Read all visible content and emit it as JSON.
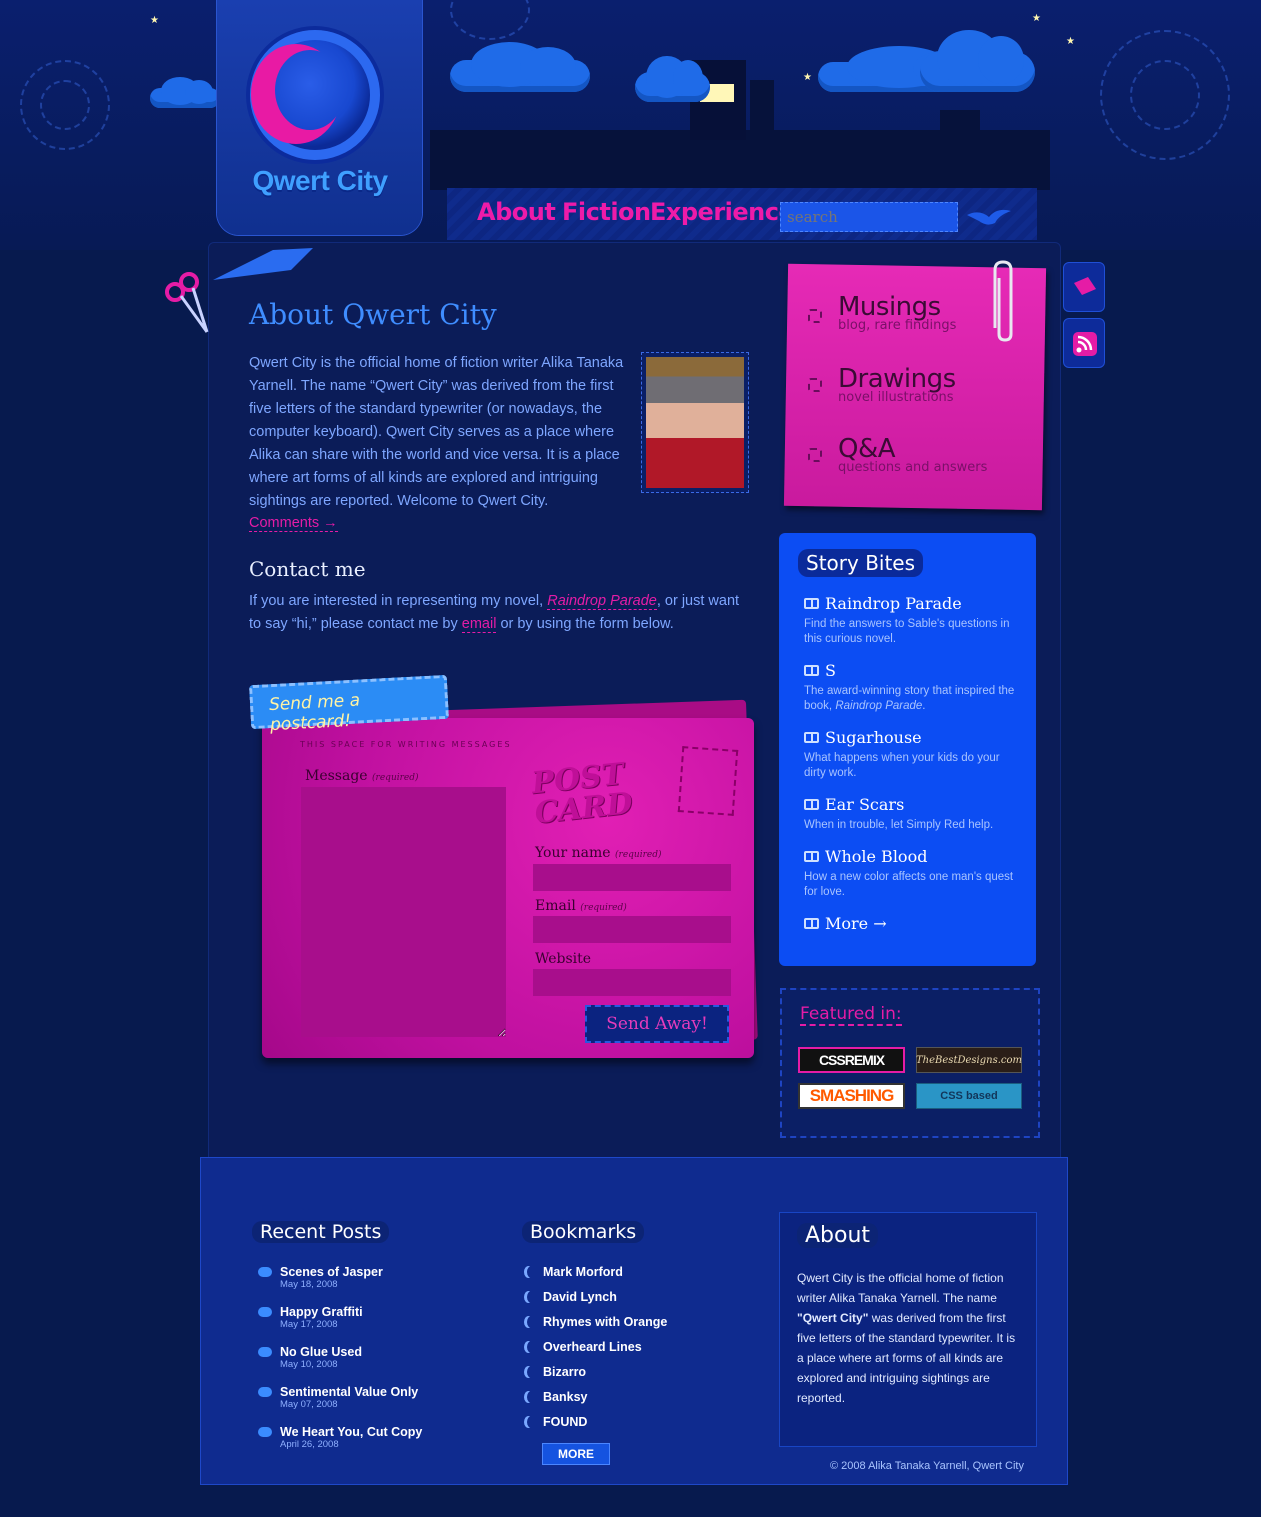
{
  "header": {
    "logo_text": "Qwert City",
    "nav": [
      "About",
      "Fiction",
      "Experience"
    ],
    "search_placeholder": "search"
  },
  "main": {
    "title": "About Qwert City",
    "about": "Qwert City is the official home of fiction writer Alika Tanaka Yarnell. The name “Qwert City” was derived from the first five letters of the standard typewriter (or nowadays, the computer keyboard). Qwert City serves as a place where Alika can share with the world and vice versa. It is a place where art forms of all kinds are explored and intriguing sightings are reported. Welcome to Qwert City.",
    "comments_link": "Comments →",
    "contact_title": "Contact me",
    "contact_before": "If you are interested in representing my novel, ",
    "contact_link_novel": "Raindrop Parade",
    "contact_middle": ", or just want to say “hi,” please contact me by ",
    "contact_link_email": "email",
    "contact_after": " or by using the form below."
  },
  "postcard": {
    "tab_label": "Send me a postcard!",
    "header_text": "THIS SPACE FOR WRITING MESSAGES",
    "message_label": "Message",
    "required": "(required)",
    "stamp_text": "POST CARD",
    "name_label": "Your name",
    "email_label": "Email",
    "website_label": "Website",
    "send_label": "Send Away!"
  },
  "sticky": {
    "items": [
      {
        "title": "Musings",
        "sub": "blog, rare findings"
      },
      {
        "title": "Drawings",
        "sub": "novel illustrations"
      },
      {
        "title": "Q&A",
        "sub": "questions and answers"
      }
    ]
  },
  "story_bites": {
    "title": "Story Bites",
    "items": [
      {
        "title": "Raindrop Parade",
        "desc": "Find the answers to Sable's questions in this curious novel."
      },
      {
        "title": "S",
        "desc": "The award-winning story that inspired the book, ",
        "desc_em": "Raindrop Parade",
        "desc_end": "."
      },
      {
        "title": "Sugarhouse",
        "desc": "What happens when your kids do your dirty work."
      },
      {
        "title": "Ear Scars",
        "desc": "When in trouble, let Simply Red help."
      },
      {
        "title": "Whole Blood",
        "desc": "How a new color affects one man's quest for love."
      }
    ],
    "more": "More →"
  },
  "featured": {
    "title": "Featured in:",
    "badges": [
      "CSSREMIX",
      "TheBestDesigns.com",
      "SMASHING",
      "CSS based"
    ]
  },
  "footer": {
    "recent_title": "Recent Posts",
    "posts": [
      {
        "title": "Scenes of Jasper",
        "date": "May 18, 2008"
      },
      {
        "title": "Happy Graffiti",
        "date": "May 17, 2008"
      },
      {
        "title": "No Glue Used",
        "date": "May 10, 2008"
      },
      {
        "title": "Sentimental Value Only",
        "date": "May 07, 2008"
      },
      {
        "title": "We Heart You, Cut Copy",
        "date": "April 26, 2008"
      }
    ],
    "bookmarks_title": "Bookmarks",
    "bookmarks": [
      "Mark Morford",
      "David Lynch",
      "Rhymes with Orange",
      "Overheard Lines",
      "Bizarro",
      "Banksy",
      "FOUND"
    ],
    "more_label": "MORE",
    "about_title": "About",
    "about_before": "Qwert City is the official home of fiction writer Alika Tanaka Yarnell. The name ",
    "about_bold": "\"Qwert City\"",
    "about_after": " was derived from the first five letters of the standard typewriter. It is a place where art forms of all kinds are explored and intriguing sightings are reported.",
    "copyright": "© 2008 Alika Tanaka Yarnell, Qwert City"
  },
  "colors": {
    "accent_pink": "#e51ca6",
    "brand_blue": "#0c4df3",
    "background": "#071a4e"
  }
}
